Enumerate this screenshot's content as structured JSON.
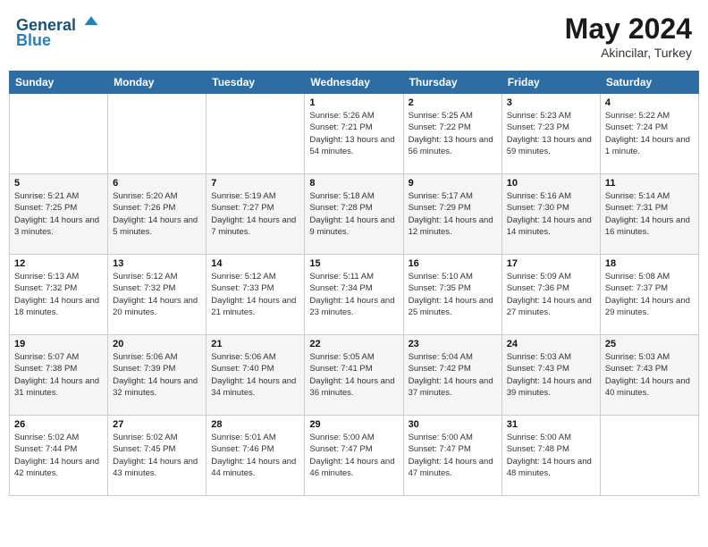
{
  "header": {
    "logo_line1": "General",
    "logo_line2": "Blue",
    "month": "May 2024",
    "location": "Akincilar, Turkey"
  },
  "weekdays": [
    "Sunday",
    "Monday",
    "Tuesday",
    "Wednesday",
    "Thursday",
    "Friday",
    "Saturday"
  ],
  "weeks": [
    [
      {
        "day": "",
        "sunrise": "",
        "sunset": "",
        "daylight": ""
      },
      {
        "day": "",
        "sunrise": "",
        "sunset": "",
        "daylight": ""
      },
      {
        "day": "",
        "sunrise": "",
        "sunset": "",
        "daylight": ""
      },
      {
        "day": "1",
        "sunrise": "Sunrise: 5:26 AM",
        "sunset": "Sunset: 7:21 PM",
        "daylight": "Daylight: 13 hours and 54 minutes."
      },
      {
        "day": "2",
        "sunrise": "Sunrise: 5:25 AM",
        "sunset": "Sunset: 7:22 PM",
        "daylight": "Daylight: 13 hours and 56 minutes."
      },
      {
        "day": "3",
        "sunrise": "Sunrise: 5:23 AM",
        "sunset": "Sunset: 7:23 PM",
        "daylight": "Daylight: 13 hours and 59 minutes."
      },
      {
        "day": "4",
        "sunrise": "Sunrise: 5:22 AM",
        "sunset": "Sunset: 7:24 PM",
        "daylight": "Daylight: 14 hours and 1 minute."
      }
    ],
    [
      {
        "day": "5",
        "sunrise": "Sunrise: 5:21 AM",
        "sunset": "Sunset: 7:25 PM",
        "daylight": "Daylight: 14 hours and 3 minutes."
      },
      {
        "day": "6",
        "sunrise": "Sunrise: 5:20 AM",
        "sunset": "Sunset: 7:26 PM",
        "daylight": "Daylight: 14 hours and 5 minutes."
      },
      {
        "day": "7",
        "sunrise": "Sunrise: 5:19 AM",
        "sunset": "Sunset: 7:27 PM",
        "daylight": "Daylight: 14 hours and 7 minutes."
      },
      {
        "day": "8",
        "sunrise": "Sunrise: 5:18 AM",
        "sunset": "Sunset: 7:28 PM",
        "daylight": "Daylight: 14 hours and 9 minutes."
      },
      {
        "day": "9",
        "sunrise": "Sunrise: 5:17 AM",
        "sunset": "Sunset: 7:29 PM",
        "daylight": "Daylight: 14 hours and 12 minutes."
      },
      {
        "day": "10",
        "sunrise": "Sunrise: 5:16 AM",
        "sunset": "Sunset: 7:30 PM",
        "daylight": "Daylight: 14 hours and 14 minutes."
      },
      {
        "day": "11",
        "sunrise": "Sunrise: 5:14 AM",
        "sunset": "Sunset: 7:31 PM",
        "daylight": "Daylight: 14 hours and 16 minutes."
      }
    ],
    [
      {
        "day": "12",
        "sunrise": "Sunrise: 5:13 AM",
        "sunset": "Sunset: 7:32 PM",
        "daylight": "Daylight: 14 hours and 18 minutes."
      },
      {
        "day": "13",
        "sunrise": "Sunrise: 5:12 AM",
        "sunset": "Sunset: 7:32 PM",
        "daylight": "Daylight: 14 hours and 20 minutes."
      },
      {
        "day": "14",
        "sunrise": "Sunrise: 5:12 AM",
        "sunset": "Sunset: 7:33 PM",
        "daylight": "Daylight: 14 hours and 21 minutes."
      },
      {
        "day": "15",
        "sunrise": "Sunrise: 5:11 AM",
        "sunset": "Sunset: 7:34 PM",
        "daylight": "Daylight: 14 hours and 23 minutes."
      },
      {
        "day": "16",
        "sunrise": "Sunrise: 5:10 AM",
        "sunset": "Sunset: 7:35 PM",
        "daylight": "Daylight: 14 hours and 25 minutes."
      },
      {
        "day": "17",
        "sunrise": "Sunrise: 5:09 AM",
        "sunset": "Sunset: 7:36 PM",
        "daylight": "Daylight: 14 hours and 27 minutes."
      },
      {
        "day": "18",
        "sunrise": "Sunrise: 5:08 AM",
        "sunset": "Sunset: 7:37 PM",
        "daylight": "Daylight: 14 hours and 29 minutes."
      }
    ],
    [
      {
        "day": "19",
        "sunrise": "Sunrise: 5:07 AM",
        "sunset": "Sunset: 7:38 PM",
        "daylight": "Daylight: 14 hours and 31 minutes."
      },
      {
        "day": "20",
        "sunrise": "Sunrise: 5:06 AM",
        "sunset": "Sunset: 7:39 PM",
        "daylight": "Daylight: 14 hours and 32 minutes."
      },
      {
        "day": "21",
        "sunrise": "Sunrise: 5:06 AM",
        "sunset": "Sunset: 7:40 PM",
        "daylight": "Daylight: 14 hours and 34 minutes."
      },
      {
        "day": "22",
        "sunrise": "Sunrise: 5:05 AM",
        "sunset": "Sunset: 7:41 PM",
        "daylight": "Daylight: 14 hours and 36 minutes."
      },
      {
        "day": "23",
        "sunrise": "Sunrise: 5:04 AM",
        "sunset": "Sunset: 7:42 PM",
        "daylight": "Daylight: 14 hours and 37 minutes."
      },
      {
        "day": "24",
        "sunrise": "Sunrise: 5:03 AM",
        "sunset": "Sunset: 7:43 PM",
        "daylight": "Daylight: 14 hours and 39 minutes."
      },
      {
        "day": "25",
        "sunrise": "Sunrise: 5:03 AM",
        "sunset": "Sunset: 7:43 PM",
        "daylight": "Daylight: 14 hours and 40 minutes."
      }
    ],
    [
      {
        "day": "26",
        "sunrise": "Sunrise: 5:02 AM",
        "sunset": "Sunset: 7:44 PM",
        "daylight": "Daylight: 14 hours and 42 minutes."
      },
      {
        "day": "27",
        "sunrise": "Sunrise: 5:02 AM",
        "sunset": "Sunset: 7:45 PM",
        "daylight": "Daylight: 14 hours and 43 minutes."
      },
      {
        "day": "28",
        "sunrise": "Sunrise: 5:01 AM",
        "sunset": "Sunset: 7:46 PM",
        "daylight": "Daylight: 14 hours and 44 minutes."
      },
      {
        "day": "29",
        "sunrise": "Sunrise: 5:00 AM",
        "sunset": "Sunset: 7:47 PM",
        "daylight": "Daylight: 14 hours and 46 minutes."
      },
      {
        "day": "30",
        "sunrise": "Sunrise: 5:00 AM",
        "sunset": "Sunset: 7:47 PM",
        "daylight": "Daylight: 14 hours and 47 minutes."
      },
      {
        "day": "31",
        "sunrise": "Sunrise: 5:00 AM",
        "sunset": "Sunset: 7:48 PM",
        "daylight": "Daylight: 14 hours and 48 minutes."
      },
      {
        "day": "",
        "sunrise": "",
        "sunset": "",
        "daylight": ""
      }
    ]
  ]
}
